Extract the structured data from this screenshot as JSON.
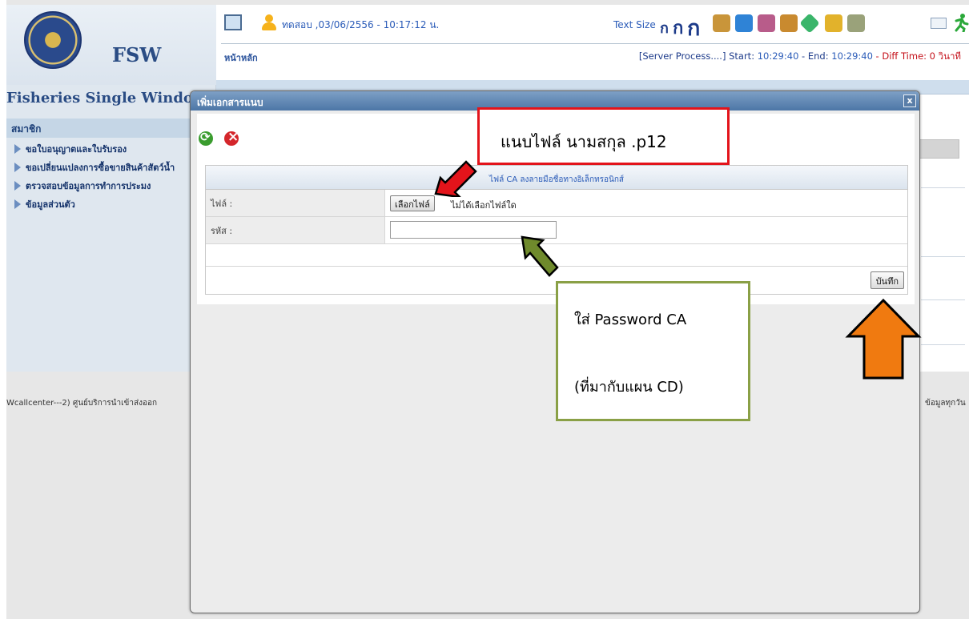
{
  "sidebar": {
    "logo_text": "FSW",
    "site_name": "Fisheries Single Window",
    "section_title": "สมาชิก",
    "items": [
      {
        "label": "ขอใบอนุญาตและใบรับรอง"
      },
      {
        "label": "ขอเปลี่ยนแปลงการซื้อขายสินค้าสัตว์น้ำ"
      },
      {
        "label": "ตรวจสอบข้อมูลการทำการประมง"
      },
      {
        "label": "ข้อมูลส่วนตัว"
      }
    ]
  },
  "header": {
    "user_info": "ทดสอบ ,03/06/2556 - 10:17:12 น.",
    "text_size_label": "Text Size",
    "text_size_glyphs": [
      "ก",
      "ก",
      "ก"
    ],
    "home_link": "หน้าหลัก",
    "server_process": "[Server Process....] Start:",
    "start_time": "10:29:40",
    "end_label": " - End:",
    "end_time": "10:29:40",
    "diff_text": " - Diff Time: 0 วินาที",
    "icons": [
      "monitor-icon",
      "user-icon",
      "mail-icon",
      "exit-icon"
    ]
  },
  "footer": {
    "left_text": "Wcallcenter---2) ศูนย์บริการนำเข้าส่งออก",
    "right_text": "ข้อมูลทุกวัน"
  },
  "modal": {
    "title": "เพิ่มเอกสารแนบ",
    "close_label": "x",
    "form_header": "ไฟล์ CA ลงลายมือชื่อทางอิเล็กทรอนิกส์",
    "file_label": "ไฟล์ :",
    "file_button": "เลือกไฟล์",
    "file_status": "ไม่ได้เลือกไฟล์ใด",
    "password_label": "รหัส :",
    "password_value": "",
    "save_button": "บันทึก"
  },
  "annotations": {
    "red_note": "แนบไฟล์ นามสกุล .p12",
    "green_note_line1": "ใส่ Password CA",
    "green_note_line2": "(ที่มากับแผน CD)",
    "colors": {
      "red": "#e3141b",
      "green": "#6f8a2c",
      "orange": "#f07a10"
    }
  }
}
